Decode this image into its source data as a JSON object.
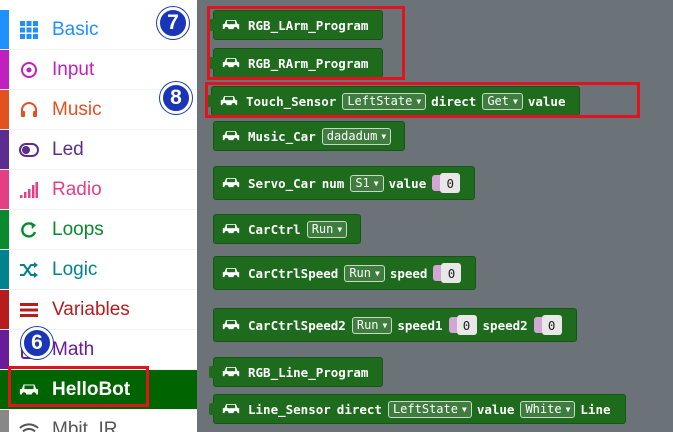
{
  "sidebar": {
    "items": [
      {
        "label": "Basic",
        "icon": "grid-icon",
        "color": "#1e90ff",
        "stripe": "#1e90ff"
      },
      {
        "label": "Input",
        "icon": "target-icon",
        "color": "#c020c0",
        "stripe": "#c020c0"
      },
      {
        "label": "Music",
        "icon": "headphones-icon",
        "color": "#e4501e",
        "stripe": "#e4501e"
      },
      {
        "label": "Led",
        "icon": "toggle-icon",
        "color": "#5c2d91",
        "stripe": "#5c2d91"
      },
      {
        "label": "Radio",
        "icon": "signal-bars-icon",
        "color": "#e63e85",
        "stripe": "#e63e85"
      },
      {
        "label": "Loops",
        "icon": "refresh-icon",
        "color": "#0a8a2e",
        "stripe": "#0a8a2e"
      },
      {
        "label": "Logic",
        "icon": "shuffle-icon",
        "color": "#00838f",
        "stripe": "#00838f"
      },
      {
        "label": "Variables",
        "icon": "list-icon",
        "color": "#b71c1c",
        "stripe": "#b71c1c"
      },
      {
        "label": "Math",
        "icon": "calculator-icon",
        "color": "#6a1b9a",
        "stripe": "#6a1b9a"
      },
      {
        "label": "HelloBot",
        "icon": "car-icon",
        "color": "#ffffff",
        "stripe": "#006400",
        "selected": true
      },
      {
        "label": "Mbit_IR",
        "icon": "wifi-icon",
        "color": "#555555",
        "stripe": "#888888"
      }
    ]
  },
  "blocks": {
    "rgb_larm": {
      "label": "RGB_LArm_Program"
    },
    "rgb_rarm": {
      "label": "RGB_RArm_Program"
    },
    "touch_sensor": {
      "label": "Touch_Sensor",
      "dropdown1": "LeftState",
      "mid": "direct",
      "dropdown2": "Get",
      "tail": "value"
    },
    "music_car": {
      "label": "Music_Car",
      "dropdown": "dadadum"
    },
    "servo_car": {
      "label": "Servo_Car",
      "mid": "num",
      "dropdown": "S1",
      "tail": "value",
      "value": "0"
    },
    "carctrl": {
      "label": "CarCtrl",
      "dropdown": "Run"
    },
    "carctrlspeed": {
      "label": "CarCtrlSpeed",
      "dropdown": "Run",
      "tail": "speed",
      "value": "0"
    },
    "carctrlspeed2": {
      "label": "CarCtrlSpeed2",
      "dropdown": "Run",
      "mid": "speed1",
      "value1": "0",
      "tail": "speed2",
      "value2": "0"
    },
    "rgb_line": {
      "label": "RGB_Line_Program"
    },
    "line_sensor": {
      "label": "Line_Sensor",
      "mid": "direct",
      "dropdown1": "LeftState",
      "mid2": "value",
      "dropdown2": "White",
      "tail": "Line"
    }
  },
  "badges": {
    "six": "6",
    "seven": "7",
    "eight": "8"
  },
  "colors": {
    "block_green": "#1e6b1e",
    "highlight_red": "#e0141e",
    "badge_blue": "#1a35b8",
    "workspace_gray": "#6b7278"
  }
}
